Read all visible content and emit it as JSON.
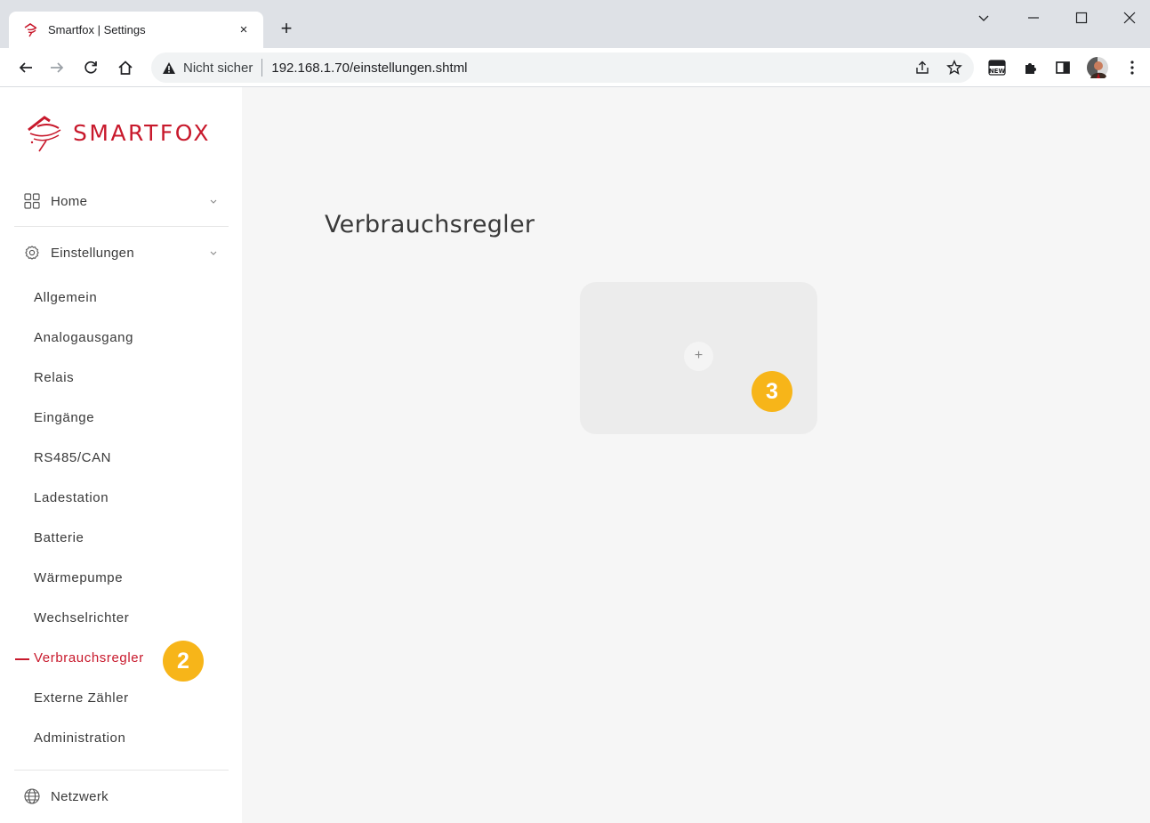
{
  "browser": {
    "tab_title": "Smartfox | Settings",
    "tab_close": "×",
    "new_tab": "+",
    "omnibox": {
      "security_label": "Nicht sicher",
      "url": "192.168.1.70/einstellungen.shtml"
    },
    "extension_badge_text": "NEW"
  },
  "brand": {
    "logo_text": "SMARTFOX",
    "accent_color": "#c8192c"
  },
  "sidebar": {
    "groups": [
      {
        "label": "Home",
        "icon": "grid-icon",
        "expanded": false
      },
      {
        "label": "Einstellungen",
        "icon": "gear-icon",
        "expanded": true
      },
      {
        "label": "Netzwerk",
        "icon": "globe-icon",
        "expanded": false
      }
    ],
    "settings_items": [
      {
        "label": "Allgemein",
        "active": false
      },
      {
        "label": "Analogausgang",
        "active": false
      },
      {
        "label": "Relais",
        "active": false
      },
      {
        "label": "Eingänge",
        "active": false
      },
      {
        "label": "RS485/CAN",
        "active": false
      },
      {
        "label": "Ladestation",
        "active": false
      },
      {
        "label": "Batterie",
        "active": false
      },
      {
        "label": "Wärmepumpe",
        "active": false
      },
      {
        "label": "Wechselrichter",
        "active": false
      },
      {
        "label": "Verbrauchsregler",
        "active": true
      },
      {
        "label": "Externe Zähler",
        "active": false
      },
      {
        "label": "Administration",
        "active": false
      }
    ]
  },
  "main": {
    "page_title": "Verbrauchsregler",
    "add_card_symbol": "+"
  },
  "annotations": {
    "step_2": "2",
    "step_3": "3",
    "badge_color": "#f7b519"
  }
}
